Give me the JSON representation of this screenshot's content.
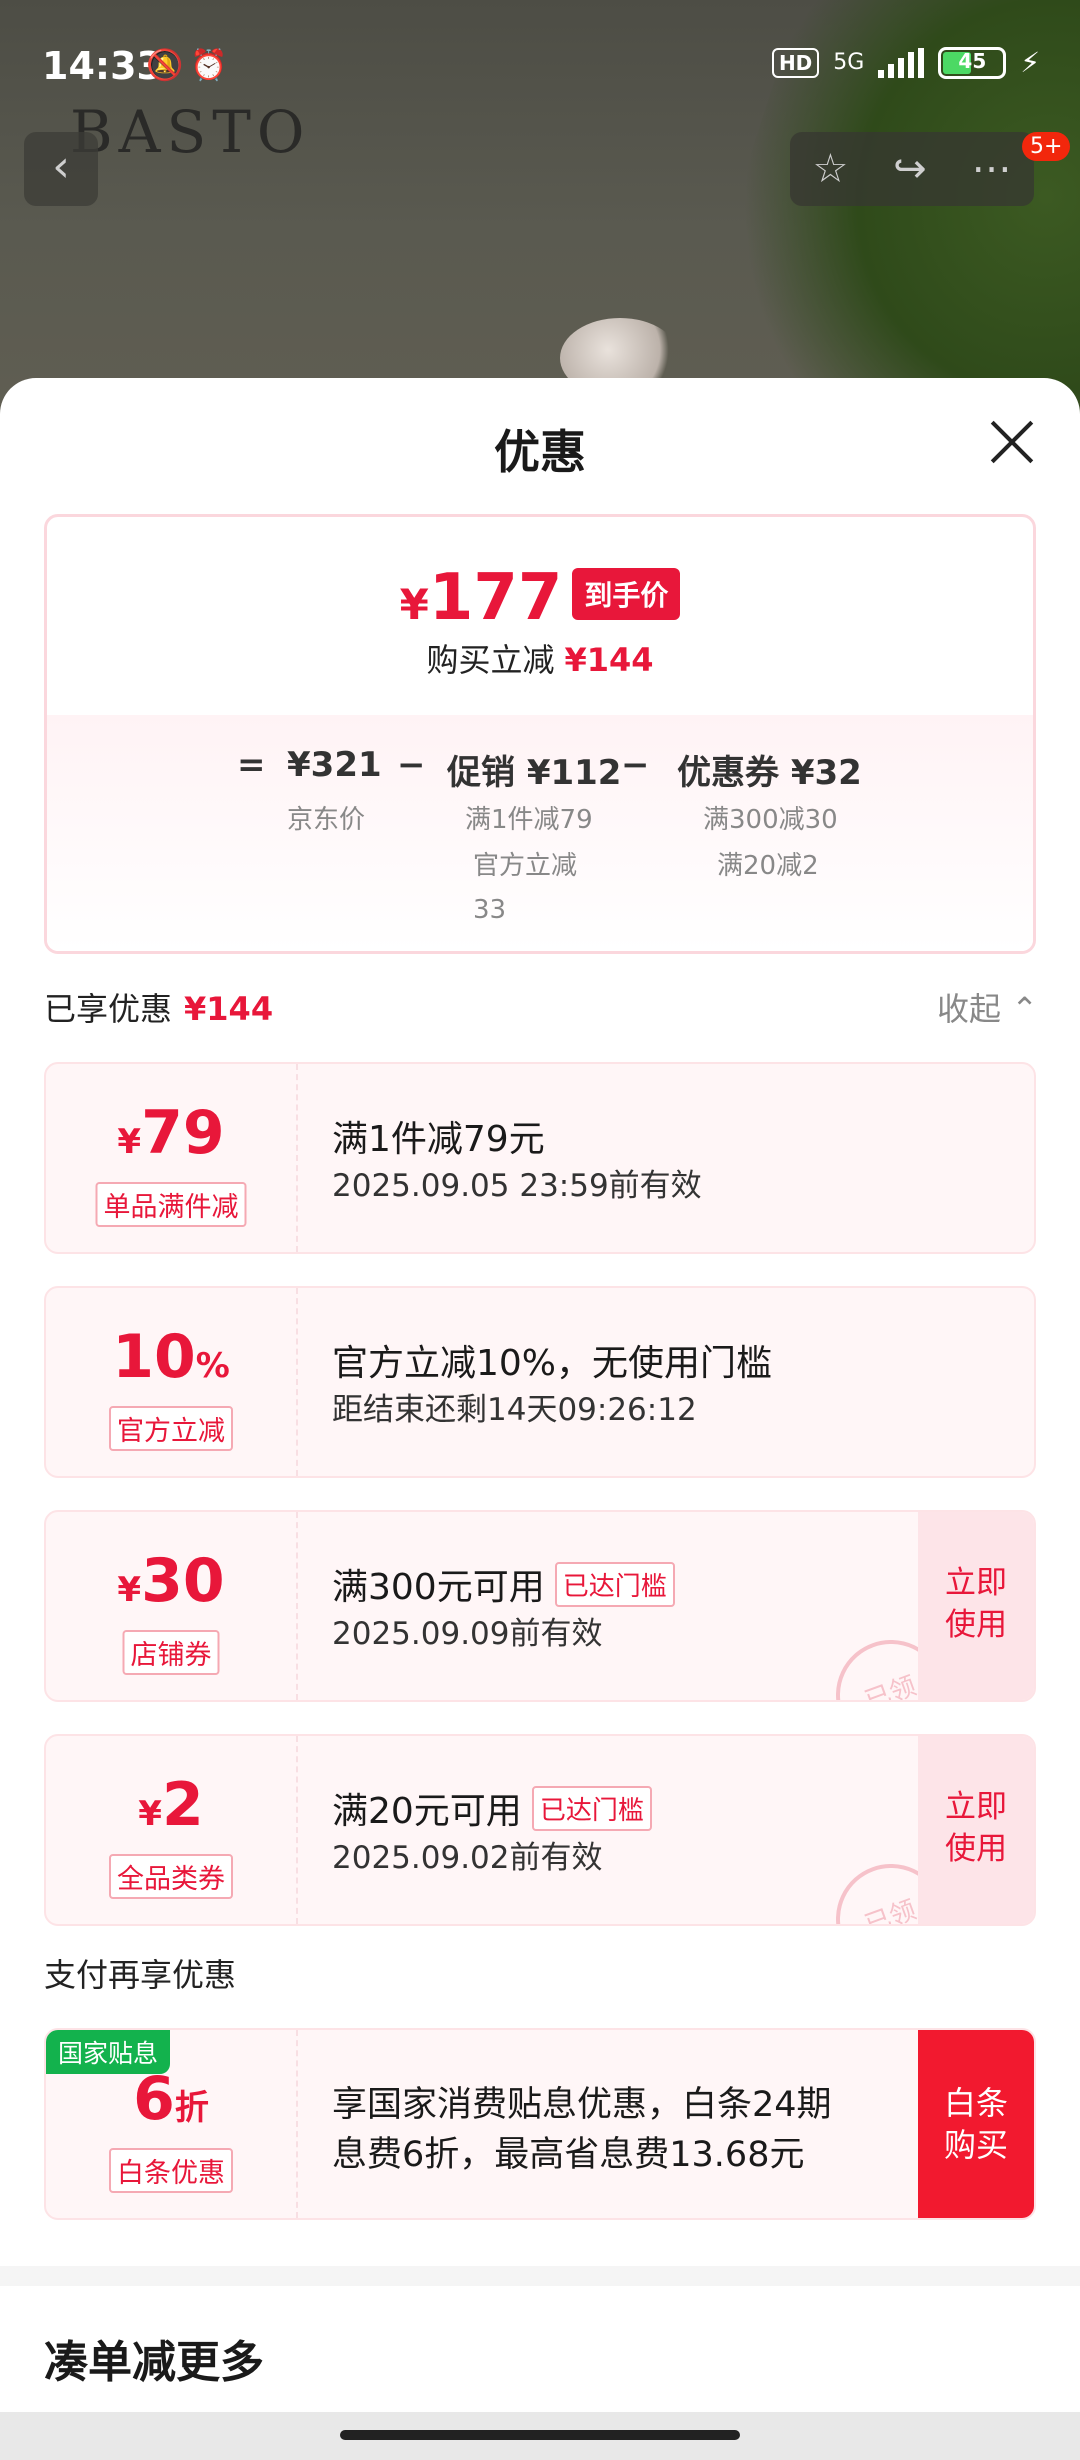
{
  "status_bar": {
    "time": "14:33",
    "hd": "HD",
    "network": "5G",
    "battery": "45"
  },
  "product_header": {
    "brand": "BASTO",
    "badge": "5+"
  },
  "sheet": {
    "title": "优惠"
  },
  "summary": {
    "currency": "¥",
    "final_price": "177",
    "final_tag": "到手价",
    "reduce_label": "购买立减",
    "reduce_amount": "¥144",
    "equals": "=",
    "minus": "−",
    "jd_price": "¥321",
    "jd_price_label": "京东价",
    "promo": "促销 ¥112",
    "promo_detail_1": "满1件减79",
    "promo_detail_2": "官方立减",
    "promo_detail_3": "33",
    "coupon": "优惠券 ¥32",
    "coupon_detail_1": "满300减30",
    "coupon_detail_2": "满20减2"
  },
  "enjoyed": {
    "label": "已享优惠",
    "amount": "¥144",
    "collapse": "收起"
  },
  "cards": [
    {
      "currency": "¥",
      "value": "79",
      "label": "单品满件减",
      "title": "满1件减79元",
      "subtitle": "2025.09.05 23:59前有效"
    },
    {
      "value": "10",
      "unit": "%",
      "label": "官方立减",
      "title": "官方立减10%，无使用门槛",
      "subtitle": "距结束还剩14天09:26:12"
    },
    {
      "currency": "¥",
      "value": "30",
      "label": "店铺券",
      "title": "满300元可用",
      "pill": "已达门槛",
      "subtitle": "2025.09.09前有效",
      "action": "立即使用",
      "stamp": "已领"
    },
    {
      "currency": "¥",
      "value": "2",
      "label": "全品类券",
      "title": "满20元可用",
      "pill": "已达门槛",
      "subtitle": "2025.09.02前有效",
      "action": "立即使用",
      "stamp": "已领"
    }
  ],
  "pay": {
    "title": "支付再享优惠",
    "gov_tag": "国家贴息",
    "value": "6",
    "unit": "折",
    "label": "白条优惠",
    "line1": "享国家消费贴息优惠，白条24期",
    "line2": "息费6折，最高省息费13.68元",
    "action": "白条购买"
  },
  "more": {
    "title": "凑单减更多"
  }
}
